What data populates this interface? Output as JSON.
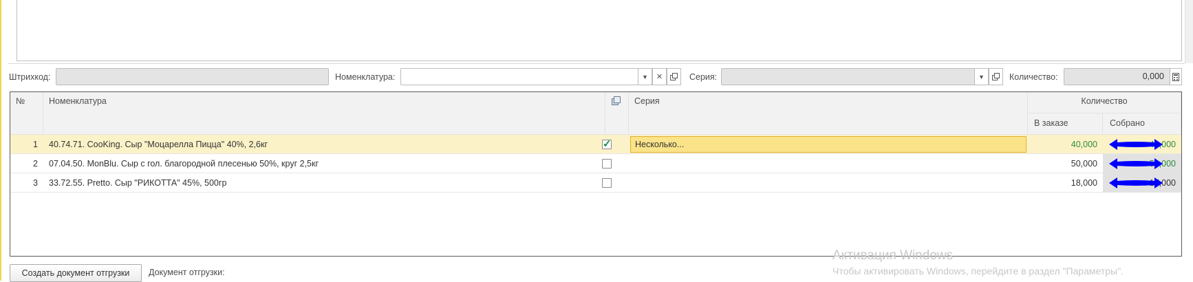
{
  "filters": {
    "barcode_label": "Штрихкод:",
    "nomenclature_label": "Номенклатура:",
    "nomenclature_value": "",
    "series_label": "Серия:",
    "quantity_label": "Количество:",
    "quantity_value": "0,000"
  },
  "table": {
    "headers": {
      "num": "№",
      "nomenclature": "Номенклатура",
      "series": "Серия",
      "quantity": "Количество",
      "ordered": "В заказе",
      "collected": "Собрано"
    },
    "rows": [
      {
        "num": "1",
        "nomenclature": "40.74.71. CooKing. Сыр \"Моцарелла Пицца\" 40%, 2,6кг",
        "checked": true,
        "series": "Несколько...",
        "ordered": "40,000",
        "collected": "40,000"
      },
      {
        "num": "2",
        "nomenclature": "07.04.50. MonBlu. Сыр с гол. благородной плесенью 50%, круг 2,5кг",
        "checked": false,
        "series": "",
        "ordered": "50,000",
        "collected": "53,000"
      },
      {
        "num": "3",
        "nomenclature": "33.72.55. Pretto. Сыр \"РИКОТТА\" 45%, 500гр",
        "checked": false,
        "series": "",
        "ordered": "18,000",
        "collected": "17,000"
      }
    ]
  },
  "footer": {
    "create_button": "Создать документ отгрузки",
    "document_label": "Документ отгрузки:"
  },
  "watermark": {
    "line1": "Активация Windows",
    "line2": "Чтобы активировать Windows, перейдите в раздел \"Параметры\"."
  },
  "colors": {
    "selected_row": "#fcf2c8",
    "series_edit": "#fbe38a",
    "green_value": "#2e8b3a",
    "annotation_arrow": "#0000ff"
  },
  "icons": [
    "dropdown-arrow-icon",
    "clear-icon",
    "open-icon",
    "calculator-icon",
    "copy-columns-icon",
    "checkmark-icon",
    "double-arrow-icon"
  ]
}
